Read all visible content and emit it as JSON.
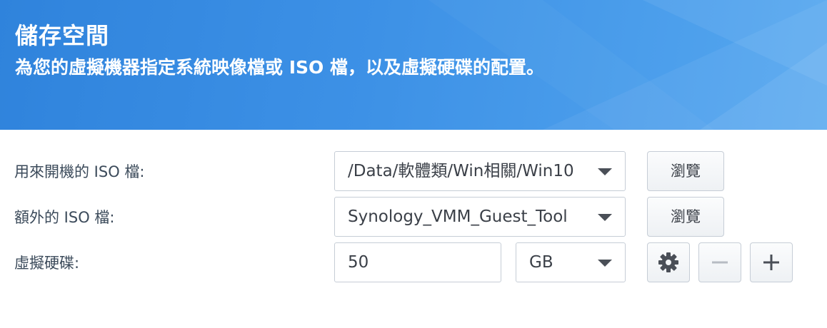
{
  "header": {
    "title": "儲存空間",
    "subtitle": "為您的虛擬機器指定系統映像檔或 ISO 檔，以及虛擬硬碟的配置。"
  },
  "form": {
    "boot_iso": {
      "label": "用來開機的 ISO 檔:",
      "value": "/Data/軟體類/Win相關/Win10",
      "browse_label": "瀏覽"
    },
    "extra_iso": {
      "label": "額外的 ISO 檔:",
      "value": "Synology_VMM_Guest_Tool",
      "browse_label": "瀏覽"
    },
    "virtual_disk": {
      "label": "虛擬硬碟:",
      "size_value": "50",
      "unit_value": "GB"
    }
  },
  "icons": {
    "settings": "gear-icon",
    "remove": "minus-icon",
    "add": "plus-icon",
    "dropdown": "chevron-down-icon"
  },
  "colors": {
    "banner_start": "#2f83dc",
    "banner_end": "#55a7ef",
    "label_text": "#3b4a5a",
    "border": "#c6cdd6"
  }
}
